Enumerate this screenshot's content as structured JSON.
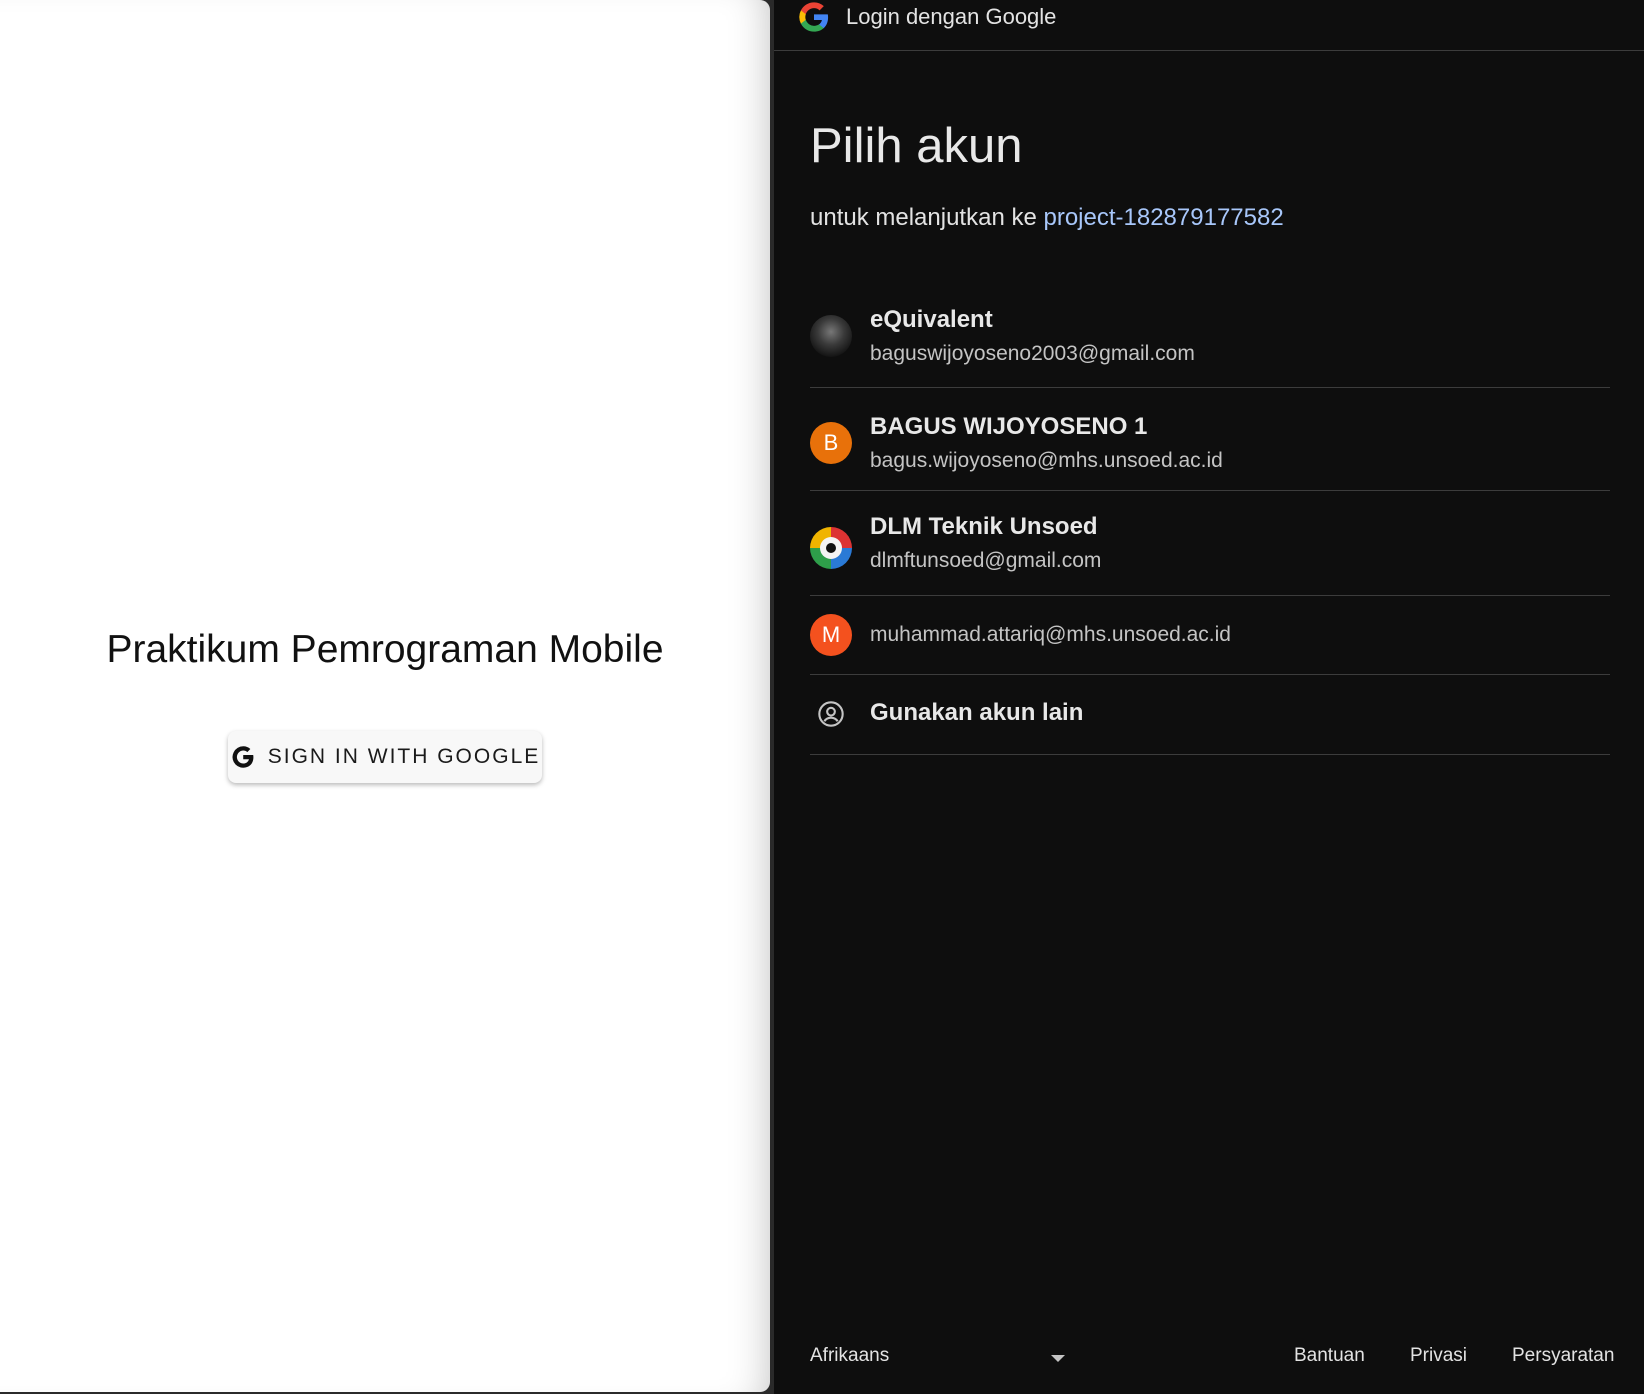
{
  "app": {
    "title": "Praktikum Pemrograman Mobile",
    "sign_in_label": "SIGN IN WITH GOOGLE"
  },
  "google_dialog": {
    "header_title": "Login dengan Google",
    "heading": "Pilih akun",
    "subtitle_prefix": "untuk melanjutkan ke",
    "project_name": "project-182879177582",
    "accounts": [
      {
        "name": "eQuivalent",
        "email": "baguswijoyoseno2003@gmail.com",
        "avatar_type": "photo"
      },
      {
        "name": "BAGUS WIJOYOSENO 1",
        "email": "bagus.wijoyoseno@mhs.unsoed.ac.id",
        "avatar_letter": "B",
        "avatar_color": "#e8710a"
      },
      {
        "name": "DLM Teknik Unsoed",
        "email": "dlmftunsoed@gmail.com",
        "avatar_type": "logo"
      },
      {
        "email": "muhammad.attariq@mhs.unsoed.ac.id",
        "avatar_letter": "M",
        "avatar_color": "#f4511e"
      }
    ],
    "use_other_account": "Gunakan akun lain",
    "footer": {
      "language": "Afrikaans",
      "help": "Bantuan",
      "privacy": "Privasi",
      "terms": "Persyaratan"
    }
  },
  "colors": {
    "dialog_background": "#0e0e0e",
    "link_blue": "#a8c7fa",
    "app_background": "#ffffff"
  }
}
